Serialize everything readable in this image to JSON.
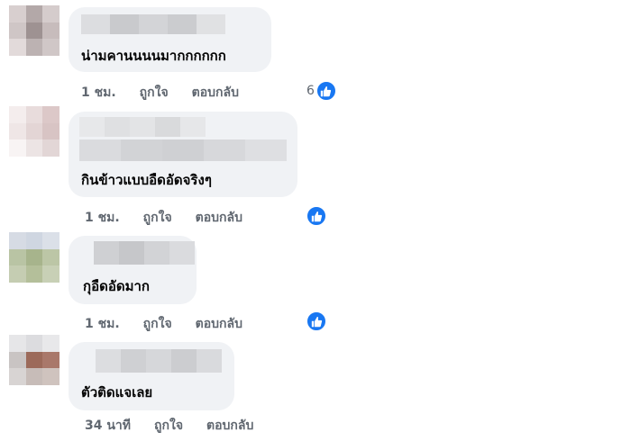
{
  "colors": {
    "accent": "#1877f2",
    "bubble": "#f0f2f5",
    "meta_text": "#606770"
  },
  "comments": [
    {
      "text": "น่ามคานนนนมากกกกกก",
      "time": "1 ชม.",
      "like": "ถูกใจ",
      "reply": "ตอบกลับ",
      "reaction_count": "6",
      "icon": "like-icon"
    },
    {
      "text": "กินข้าวแบบอืดอัดจริงๆ",
      "time": "1 ชม.",
      "like": "ถูกใจ",
      "reply": "ตอบกลับ",
      "reaction_count": "",
      "icon": "like-icon"
    },
    {
      "text": "กุอืดอัดมาก",
      "time": "1 ชม.",
      "like": "ถูกใจ",
      "reply": "ตอบกลับ",
      "reaction_count": "",
      "icon": "like-icon"
    },
    {
      "text": "ตัวติดแจเลย",
      "time": "34 นาที",
      "like": "ถูกใจ",
      "reply": "ตอบกลับ"
    }
  ]
}
